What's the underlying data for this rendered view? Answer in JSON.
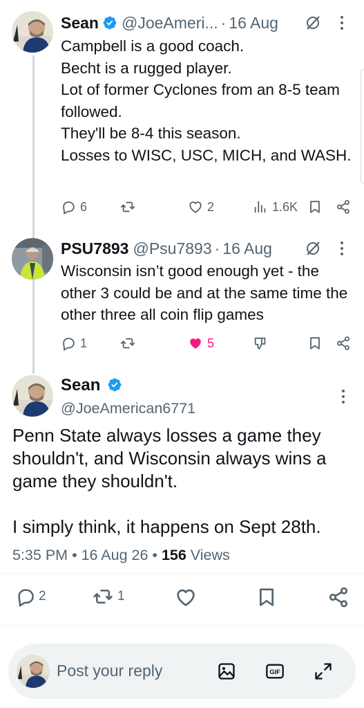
{
  "tweets": [
    {
      "name": "Sean",
      "handle": "@JoeAmeri...",
      "dot": "·",
      "date": "16 Aug",
      "body": "Campbell is a good coach.\nBecht is a rugged player.\nLot of former Cyclones from an 8-5 team followed.\nThey'll be 8-4 this season.\nLosses to WISC, USC, MICH, and WASH.",
      "replies": "6",
      "reposts": "",
      "likes": "2",
      "views": "1.6K",
      "liked": false
    },
    {
      "name": "PSU7893",
      "handle": "@Psu7893",
      "dot": "·",
      "date": "16 Aug",
      "body": "Wisconsin isn’t good enough yet - the other 3 could be and at the same time the other three all coin flip games",
      "replies": "1",
      "reposts": "",
      "likes": "5",
      "liked": true
    }
  ],
  "main_tweet": {
    "name": "Sean",
    "handle": "@JoeAmerican6771",
    "body_line1": "Penn State always losses a game they shouldn't, and Wisconsin always wins a game they shouldn't.",
    "body_line2": "I simply think, it happens on Sept 28th.",
    "time": "5:35 PM",
    "sep": "•",
    "date": "16 Aug 26",
    "views_count": "156",
    "views_label": "Views",
    "replies": "2",
    "reposts": "1"
  },
  "reply_bar": {
    "placeholder": "Post your reply"
  },
  "colors": {
    "accent": "#1d9bf0",
    "like_active": "#f91880",
    "muted": "#536471",
    "text": "#0f1419"
  },
  "icons": [
    "verified-badge-icon",
    "grok-icon",
    "more-icon",
    "reply-icon",
    "repost-icon",
    "like-icon",
    "views-icon",
    "bookmark-icon",
    "share-icon",
    "downvote-icon",
    "image-icon",
    "gif-icon",
    "expand-icon"
  ]
}
